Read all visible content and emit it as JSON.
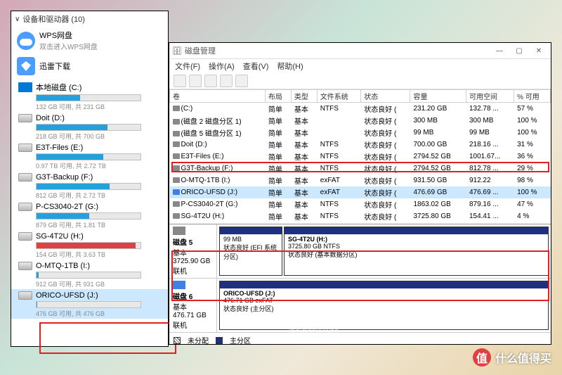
{
  "explorer": {
    "header": "设备和驱动器 (10)",
    "wps": {
      "name": "WPS网盘",
      "sub": "双击进入WPS网盘"
    },
    "xunlei": {
      "name": "迅雷下载"
    },
    "drives": [
      {
        "name": "本地磁盘 (C:)",
        "info": "132 GB 可用, 共 231 GB",
        "pct": 42,
        "type": "win"
      },
      {
        "name": "Doit (D:)",
        "info": "218 GB 可用, 共 700 GB",
        "pct": 68,
        "type": "hdd"
      },
      {
        "name": "E3T-Files (E:)",
        "info": "0.97 TB 可用, 共 2.72 TB",
        "pct": 64,
        "type": "hdd"
      },
      {
        "name": "G3T-Backup (F:)",
        "info": "812 GB 可用, 共 2.72 TB",
        "pct": 70,
        "type": "hdd"
      },
      {
        "name": "P-CS3040-2T (G:)",
        "info": "879 GB 可用, 共 1.81 TB",
        "pct": 51,
        "type": "hdd"
      },
      {
        "name": "SG-4T2U (H:)",
        "info": "154 GB 可用, 共 3.63 TB",
        "pct": 95,
        "type": "hdd",
        "red": true
      },
      {
        "name": "O-MTQ-1TB (I:)",
        "info": "912 GB 可用, 共 931 GB",
        "pct": 2,
        "type": "hdd",
        "green": true
      },
      {
        "name": "ORICO-UFSD (J:)",
        "info": "476 GB 可用, 共 476 GB",
        "pct": 1,
        "type": "hdd",
        "sel": true
      }
    ]
  },
  "dm": {
    "title": "磁盘管理",
    "menus": [
      "文件(F)",
      "操作(A)",
      "查看(V)",
      "帮助(H)"
    ],
    "columns": [
      "卷",
      "布局",
      "类型",
      "文件系统",
      "状态",
      "容量",
      "可用空间",
      "% 可用"
    ],
    "volumes": [
      {
        "n": "(C:)",
        "l": "简单",
        "t": "基本",
        "fs": "NTFS",
        "s": "状态良好 (",
        "c": "231.20 GB",
        "f": "132.78 ...",
        "p": "57 %"
      },
      {
        "n": "(磁盘 2 磁盘分区 1)",
        "l": "简单",
        "t": "基本",
        "fs": "",
        "s": "状态良好 (",
        "c": "300 MB",
        "f": "300 MB",
        "p": "100 %"
      },
      {
        "n": "(磁盘 5 磁盘分区 1)",
        "l": "简单",
        "t": "基本",
        "fs": "",
        "s": "状态良好 (",
        "c": "99 MB",
        "f": "99 MB",
        "p": "100 %"
      },
      {
        "n": "Doit (D:)",
        "l": "简单",
        "t": "基本",
        "fs": "NTFS",
        "s": "状态良好 (",
        "c": "700.00 GB",
        "f": "218.16 ...",
        "p": "31 %"
      },
      {
        "n": "E3T-Files (E:)",
        "l": "简单",
        "t": "基本",
        "fs": "NTFS",
        "s": "状态良好 (",
        "c": "2794.52 GB",
        "f": "1001.67...",
        "p": "36 %"
      },
      {
        "n": "G3T-Backup (F:)",
        "l": "简单",
        "t": "基本",
        "fs": "NTFS",
        "s": "状态良好 (",
        "c": "2794.52 GB",
        "f": "812.78 ...",
        "p": "29 %"
      },
      {
        "n": "O-MTQ-1TB (I:)",
        "l": "简单",
        "t": "基本",
        "fs": "exFAT",
        "s": "状态良好 (",
        "c": "931.50 GB",
        "f": "912.22",
        "p": "98 %"
      },
      {
        "n": "ORICO-UFSD (J:)",
        "l": "简单",
        "t": "基本",
        "fs": "exFAT",
        "s": "状态良好 (",
        "c": "476.69 GB",
        "f": "476.69 ...",
        "p": "100 %",
        "usb": true,
        "sel": true
      },
      {
        "n": "P-CS3040-2T (G:)",
        "l": "简单",
        "t": "基本",
        "fs": "NTFS",
        "s": "状态良好 (",
        "c": "1863.02 GB",
        "f": "879.16 ...",
        "p": "47 %"
      },
      {
        "n": "SG-4T2U (H:)",
        "l": "简单",
        "t": "基本",
        "fs": "NTFS",
        "s": "状态良好 (",
        "c": "3725.80 GB",
        "f": "154.41 ...",
        "p": "4 %"
      }
    ],
    "disk5": {
      "label": "磁盘 5",
      "type": "基本",
      "size": "3725.90 GB",
      "status": "联机",
      "p1": {
        "size": "99 MB",
        "st": "状态良好 (EFI 系统分区)"
      },
      "p2": {
        "name": "SG-4T2U  (H:)",
        "size": "3725.80 GB NTFS",
        "st": "状态良好 (基本数据分区)"
      }
    },
    "disk6": {
      "label": "磁盘 6",
      "type": "基本",
      "size": "476.71 GB",
      "status": "联机",
      "p1": {
        "name": "ORICO-UFSD  (J:)",
        "size": "476.71 GB exFAT",
        "st": "状态良好 (主分区)"
      }
    },
    "legend": {
      "unalloc": "未分配",
      "primary": "主分区"
    }
  },
  "watermark": {
    "center": "@bidiankuwan",
    "badge": "值",
    "text": "什么值得买"
  }
}
